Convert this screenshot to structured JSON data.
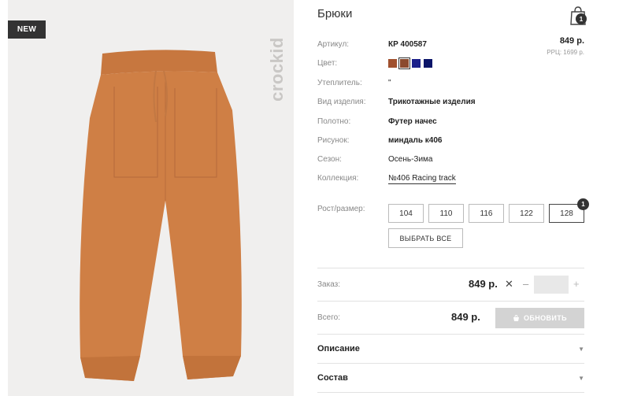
{
  "image": {
    "badge": "NEW",
    "brand": "crockid"
  },
  "product": {
    "title": "Брюки",
    "cart_count": "1",
    "price": "849 р.",
    "rrc": "РРЦ: 1699 р."
  },
  "attributes": [
    {
      "label": "Артикул:",
      "value": "КР 400587"
    },
    {
      "label": "Цвет:",
      "value": ""
    },
    {
      "label": "Утеплитель:",
      "value": "\""
    },
    {
      "label": "Вид изделия:",
      "value": "Трикотажные изделия"
    },
    {
      "label": "Полотно:",
      "value": "Футер начес"
    },
    {
      "label": "Рисунок:",
      "value": "миндаль к406"
    },
    {
      "label": "Сезон:",
      "value": "Осень-Зима"
    },
    {
      "label": "Коллекция:",
      "value": "№406 Racing track"
    }
  ],
  "colors": [
    "#a0502e",
    "#8b4a2f",
    "#1b1f8a",
    "#0b1569"
  ],
  "sizes": {
    "label": "Рост/размер:",
    "options": [
      "104",
      "110",
      "116",
      "122",
      "128"
    ],
    "selected": "128",
    "selected_count": "1",
    "select_all": "ВЫБРАТЬ ВСЕ"
  },
  "order": {
    "label": "Заказ:",
    "price": "849 р.",
    "times": "✕",
    "minus": "–",
    "plus": "+",
    "quantity": ""
  },
  "total": {
    "label": "Всего:",
    "price": "849 р.",
    "update_button": "ОБНОВИТЬ"
  },
  "sections": [
    {
      "title": "Описание",
      "arrow": "▼"
    },
    {
      "title": "Состав",
      "arrow": "▼"
    }
  ]
}
